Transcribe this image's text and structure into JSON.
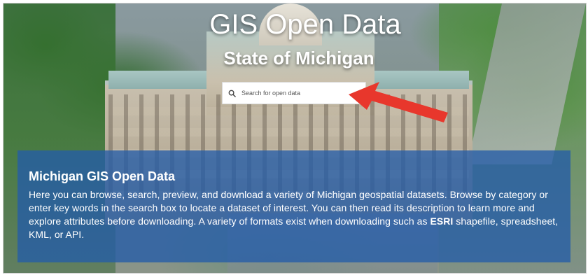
{
  "hero": {
    "title": "GIS Open Data",
    "subtitle": "State of Michigan"
  },
  "search": {
    "placeholder": "Search for open data",
    "icon": "search-icon"
  },
  "annotation": {
    "arrow_icon": "red-arrow-icon",
    "arrow_color": "#e8372c"
  },
  "info": {
    "title": "Michigan GIS Open Data",
    "body_before": "Here you can browse, search, preview, and download a variety of Michigan geospatial datasets. Browse by category or enter key words in the search box to locate a dataset of interest. You can then read its description to learn more and explore attributes before downloading. A variety of formats exist when downloading such as ",
    "body_bold": "ESRI",
    "body_after": " shapefile, spreadsheet, KML, or API.",
    "panel_color": "#245ca8"
  }
}
